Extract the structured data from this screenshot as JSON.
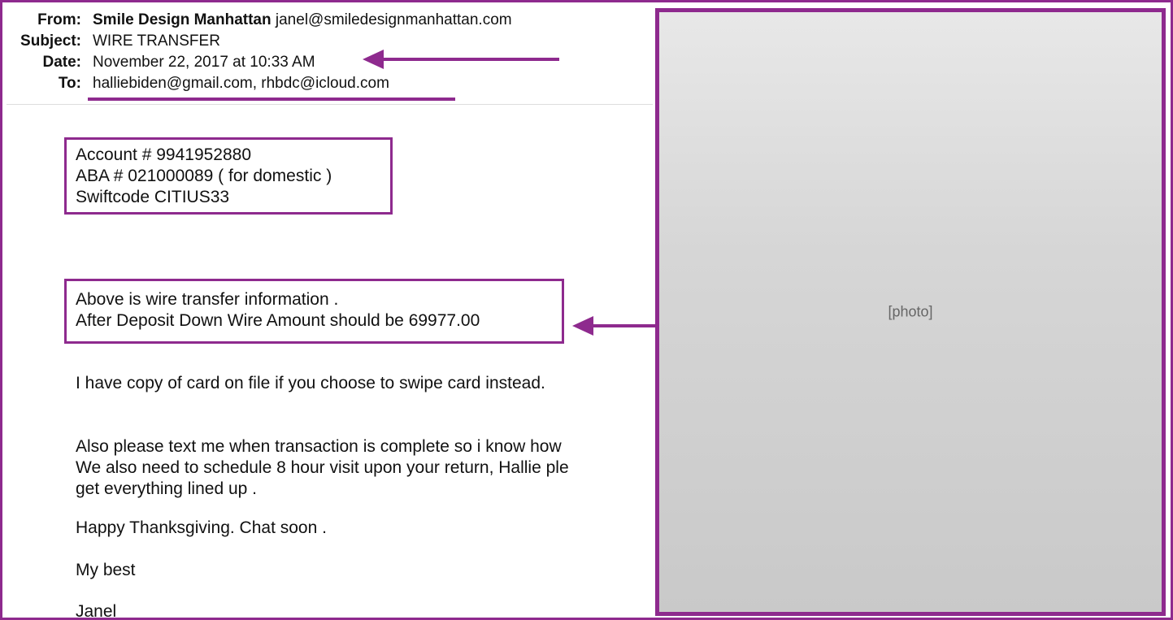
{
  "email": {
    "from_label": "From:",
    "from_name": "Smile Design Manhattan",
    "from_email": "janel@smiledesignmanhattan.com",
    "subject_label": "Subject:",
    "subject": "WIRE TRANSFER",
    "date_label": "Date:",
    "date": "November 22, 2017 at 10:33 AM",
    "to_label": "To:",
    "to": "halliebiden@gmail.com,  rhbdc@icloud.com"
  },
  "body": {
    "account_lines": [
      "Account # 9941952880",
      "ABA # 021000089 ( for domestic )",
      "Swiftcode CITIUS33"
    ],
    "wire_lines": [
      "Above is wire transfer information .",
      "After Deposit Down Wire Amount should be 69977.00"
    ],
    "card_line": "I have copy of card on file if you choose to swipe card instead.",
    "text_lines": [
      "Also please text me when transaction is complete so i know how",
      "We also need to schedule 8 hour visit upon your return, Hallie ple",
      "get everything lined up ."
    ],
    "thanksgiving": "Happy Thanksgiving. Chat soon .",
    "closing": "My best",
    "signature": "Janel"
  },
  "photo": {
    "placeholder": "[photo]"
  },
  "colors": {
    "accent": "#8e2a8e"
  }
}
